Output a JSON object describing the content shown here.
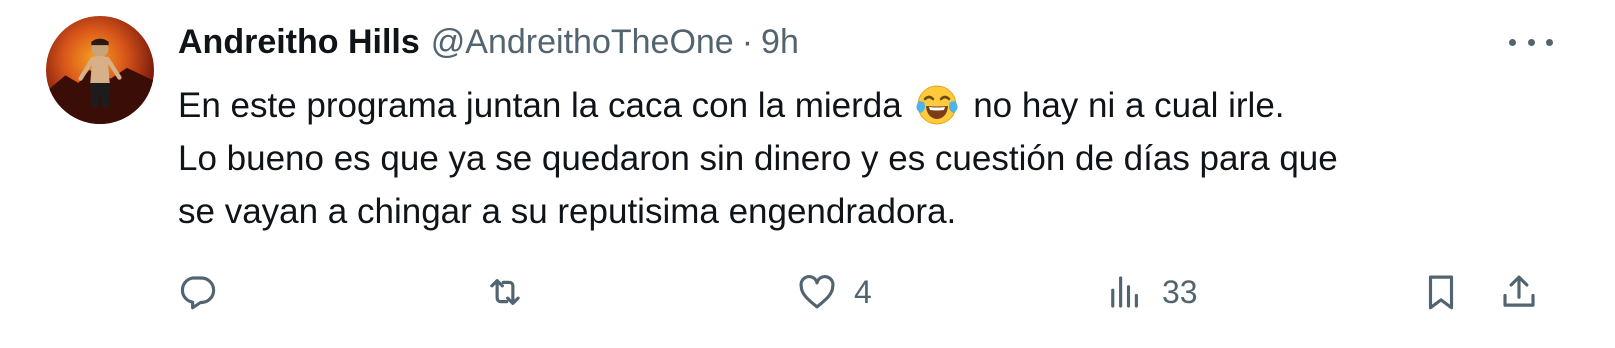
{
  "tweet": {
    "author_name": "Andreitho Hills",
    "author_handle": "@AndreithoTheOne",
    "separator": "·",
    "time": "9h",
    "text_line1_before_emoji": "En este programa juntan la caca con la mierda",
    "emoji": "face-with-tears-of-joy",
    "text_line1_after_emoji": "no hay ni a cual irle.",
    "text_line2": "Lo bueno es que ya se quedaron sin dinero y es cuestión de días para que",
    "text_line3": "se vayan a chingar a su reputisima engendradora."
  },
  "actions": {
    "reply": {
      "icon": "reply-icon",
      "count": ""
    },
    "retweet": {
      "icon": "retweet-icon",
      "count": ""
    },
    "like": {
      "icon": "heart-icon",
      "count": "4"
    },
    "views": {
      "icon": "views-icon",
      "count": "33"
    },
    "bookmark": {
      "icon": "bookmark-icon"
    },
    "share": {
      "icon": "share-icon"
    }
  },
  "colors": {
    "text_primary": "#0f1419",
    "text_secondary": "#536471",
    "background": "#ffffff"
  }
}
